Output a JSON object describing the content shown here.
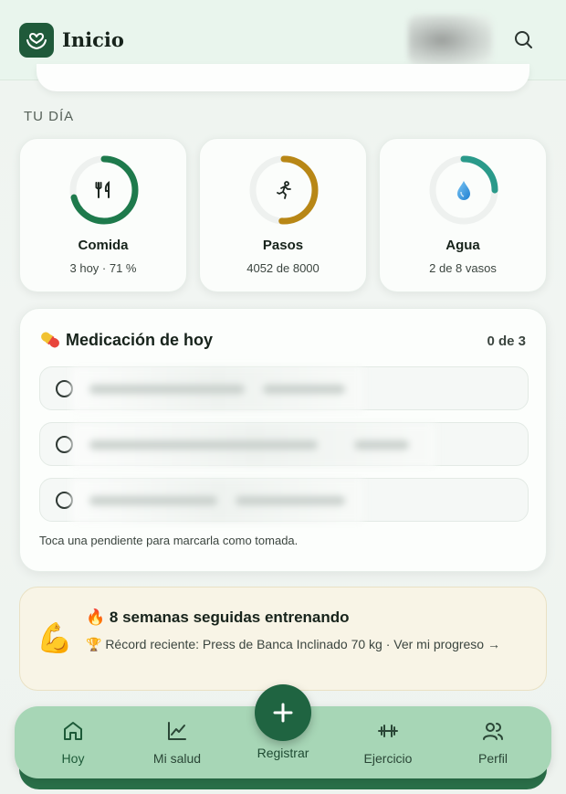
{
  "header": {
    "title": "Inicio",
    "search_icon": "search-icon",
    "logo_icon": "heart-hands-icon"
  },
  "section_label": "TU DÍA",
  "stats": [
    {
      "title": "Comida",
      "sub": "3 hoy · 71 %",
      "progress": 0.71,
      "color": "#1e7a4c",
      "icon": "fork-knife-icon"
    },
    {
      "title": "Pasos",
      "sub": "4052 de 8000",
      "progress": 0.51,
      "color": "#b88716",
      "icon": "runner-icon"
    },
    {
      "title": "Agua",
      "sub": "2 de 8 vasos",
      "progress": 0.25,
      "color": "#2a9a8a",
      "icon": "water-drop-icon"
    }
  ],
  "medication": {
    "title": "Medicación de hoy",
    "count": "0 de 3",
    "hint": "Toca una pendiente para marcarla como tomada.",
    "icon": "pill-icon"
  },
  "streak": {
    "title": "🔥 8 semanas seguidas entrenando",
    "subtitle": "🏆 Récord reciente: Press de Banca Inclinado 70 kg · Ver mi progreso →",
    "icon": "flexed-biceps-icon"
  },
  "nav": {
    "home": "Hoy",
    "health": "Mi salud",
    "register": "Registrar",
    "exercise": "Ejercicio",
    "profile": "Perfil"
  }
}
